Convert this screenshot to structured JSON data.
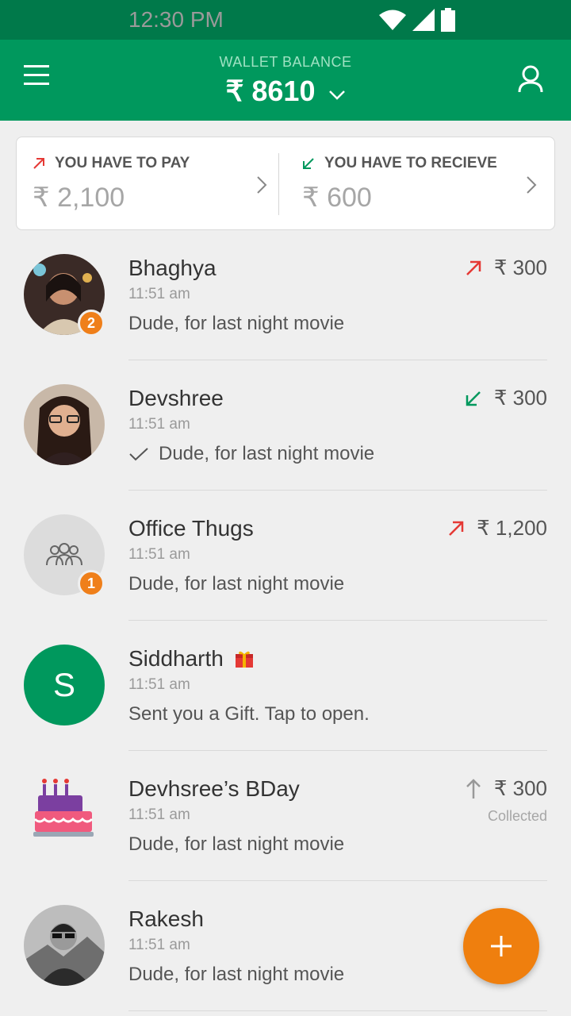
{
  "status_bar": {
    "time": "12:30 PM"
  },
  "header": {
    "wallet_label": "WALLET BALANCE",
    "wallet_amount": "₹ 8610"
  },
  "summary": {
    "pay": {
      "label": "YOU HAVE TO PAY",
      "amount": "₹ 2,100"
    },
    "receive": {
      "label": "YOU HAVE TO RECIEVE",
      "amount": "₹ 600"
    }
  },
  "colors": {
    "primary": "#00985d",
    "status_bar": "#00794a",
    "accent": "#ef7f1a",
    "pay_arrow": "#e53935",
    "receive_arrow": "#00985d"
  },
  "conversations": [
    {
      "name": "Bhaghya",
      "time": "11:51 am",
      "message": "Dude, for last night movie",
      "amount": "₹ 300",
      "direction": "pay",
      "badge": "2"
    },
    {
      "name": "Devshree",
      "time": "11:51 am",
      "message": "Dude, for last night movie",
      "amount": "₹ 300",
      "direction": "receive",
      "read": true
    },
    {
      "name": "Office Thugs",
      "time": "11:51 am",
      "message": "Dude, for last night movie",
      "amount": "₹ 1,200",
      "direction": "pay",
      "badge": "1"
    },
    {
      "name": "Siddharth",
      "initial": "S",
      "time": "11:51 am",
      "message": "Sent you a Gift. Tap to open.",
      "icon": "gift-icon"
    },
    {
      "name": "Devhsree’s BDay",
      "time": "11:51 am",
      "message": "Dude, for last night movie",
      "amount": "₹ 300",
      "amount_note": "Collected",
      "direction": "collected"
    },
    {
      "name": "Rakesh",
      "time": "11:51 am",
      "message": "Dude, for last night movie"
    }
  ]
}
